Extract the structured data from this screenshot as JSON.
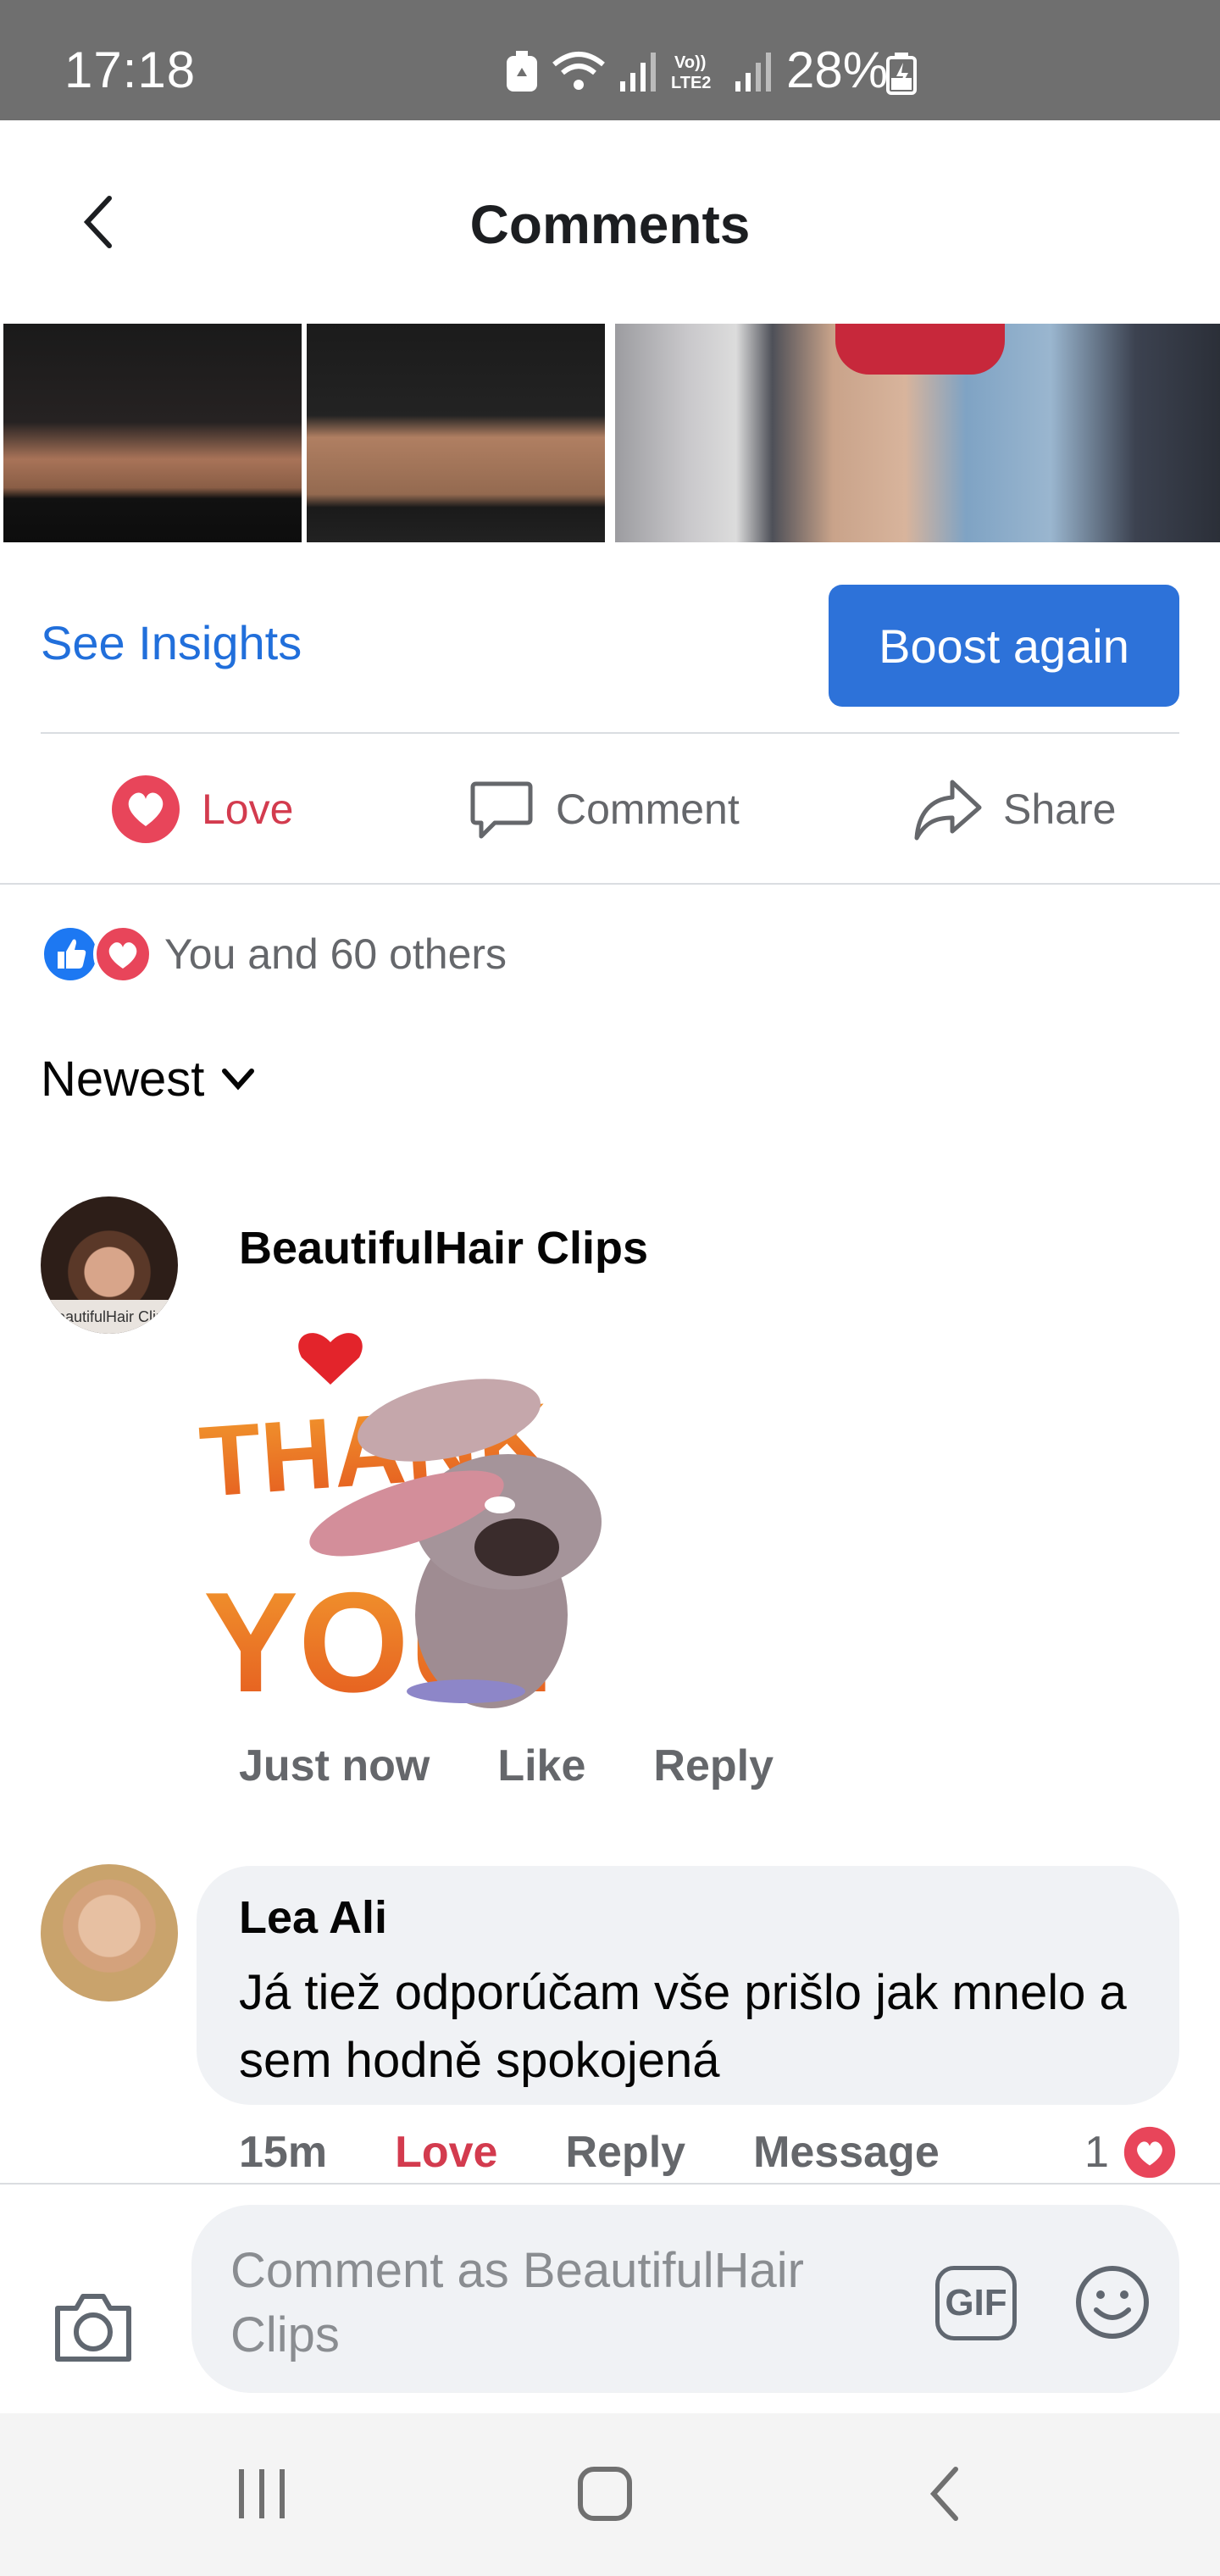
{
  "status_bar": {
    "time": "17:18",
    "battery": "28%"
  },
  "header": {
    "title": "Comments"
  },
  "insights": {
    "see_insights": "See Insights",
    "boost_again": "Boost again"
  },
  "actions": {
    "love": "Love",
    "comment": "Comment",
    "share": "Share"
  },
  "reactions_summary": "You and 60 others",
  "sort": {
    "label": "Newest"
  },
  "comments": [
    {
      "author": "BeautifulHair Clips",
      "avatar_label": "BeautifulHair Clips",
      "sticker": {
        "line1": "THANK",
        "line2": "YOU!"
      },
      "time": "Just now",
      "like": "Like",
      "reply": "Reply"
    },
    {
      "author": "Lea Ali",
      "text": "Já tiež odporúčam vše prišlo jak mnelo a sem hodně spokojená",
      "time": "15m",
      "reaction": "Love",
      "reply": "Reply",
      "message": "Message",
      "reaction_count": "1"
    }
  ],
  "composer": {
    "placeholder": "Comment as BeautifulHair Clips",
    "gif": "GIF"
  },
  "colors": {
    "accent": "#2d72d9",
    "love": "#d33b4e",
    "link": "#216fdb"
  }
}
